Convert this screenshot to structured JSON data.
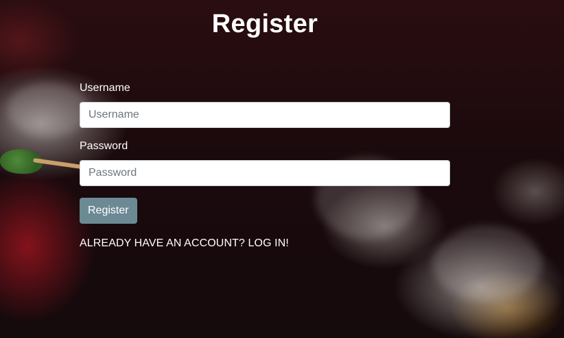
{
  "page": {
    "title": "Register"
  },
  "form": {
    "username_label": "Username",
    "username_placeholder": "Username",
    "username_value": "",
    "password_label": "Password",
    "password_placeholder": "Password",
    "password_value": "",
    "submit_label": "Register",
    "login_link": "ALREADY HAVE AN ACCOUNT? LOG IN!"
  },
  "colors": {
    "button_background": "#6c8a94",
    "text": "#ffffff"
  }
}
